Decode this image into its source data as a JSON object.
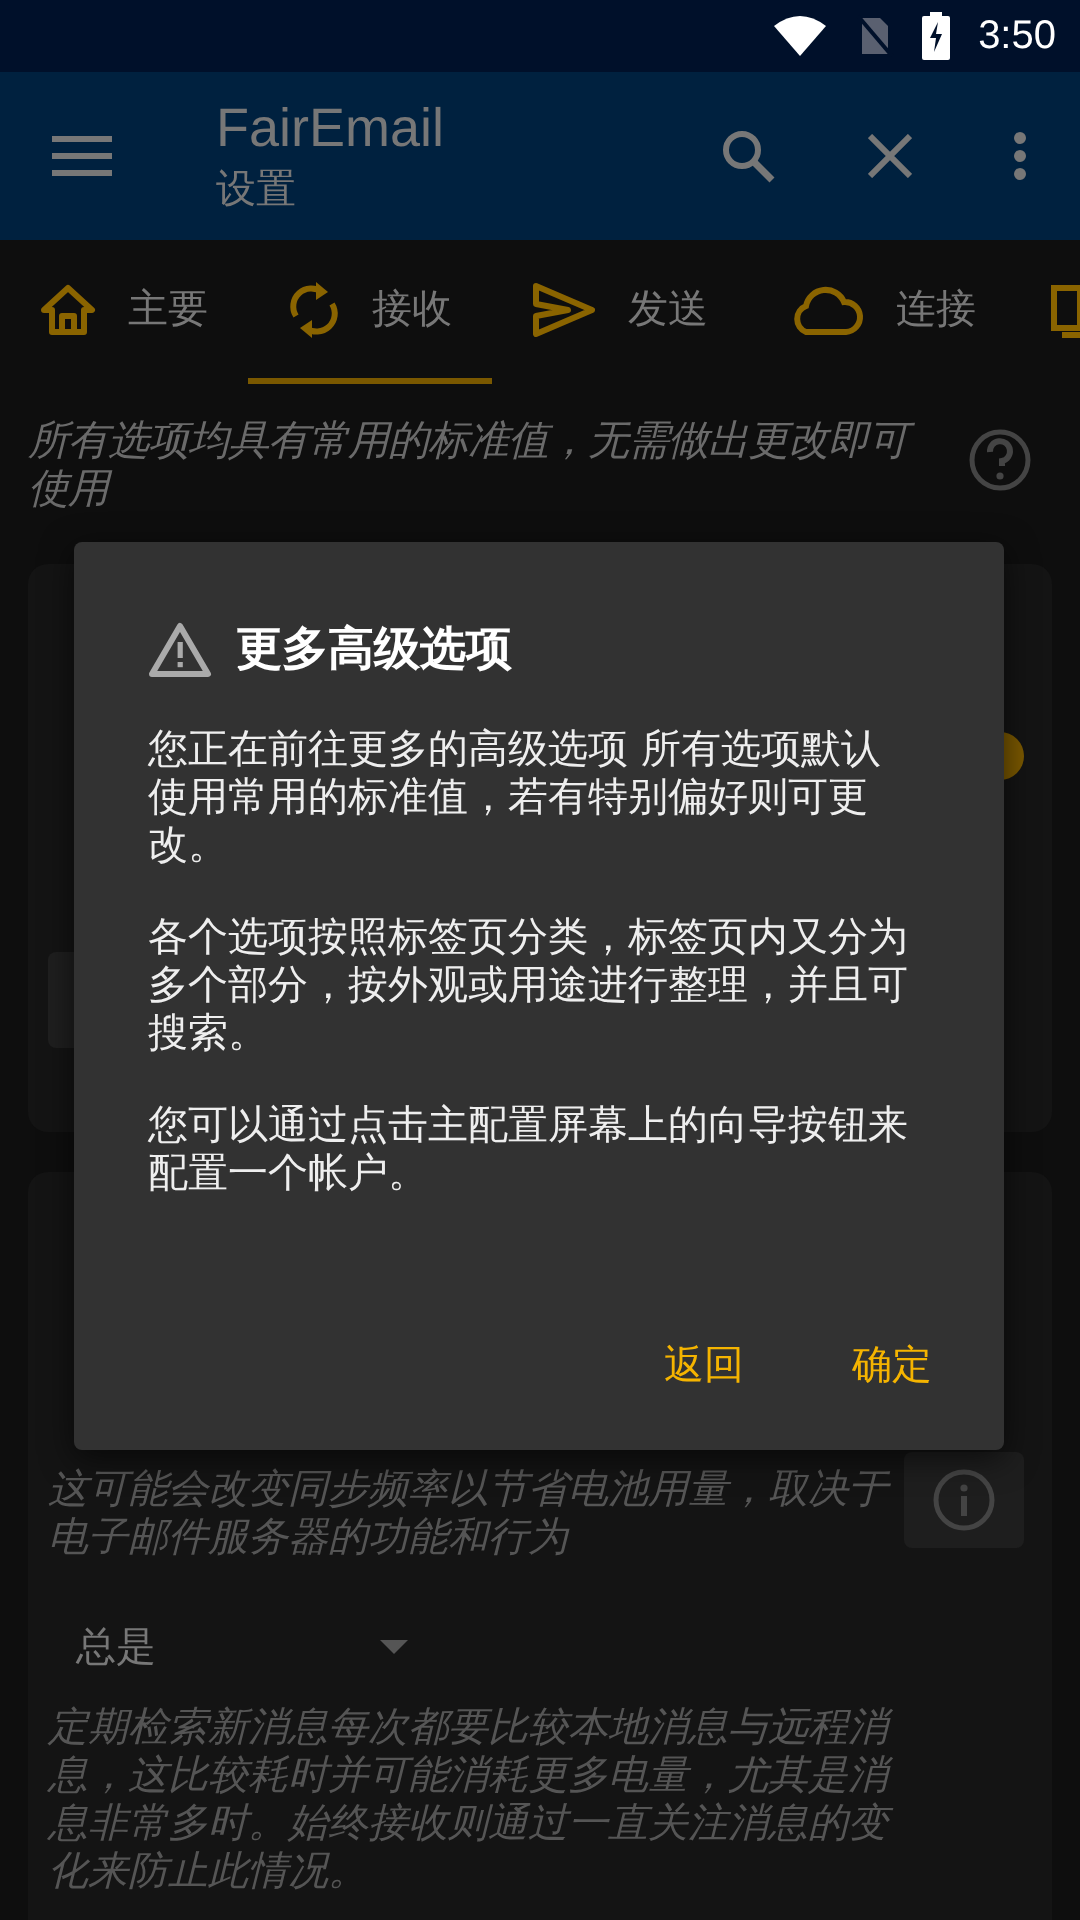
{
  "status_bar": {
    "time": "3:50"
  },
  "app_bar": {
    "title": "FairEmail",
    "subtitle": "设置"
  },
  "tabs": [
    {
      "label": "主要",
      "selected": false
    },
    {
      "label": "接收",
      "selected": true
    },
    {
      "label": "发送",
      "selected": false
    },
    {
      "label": "连接",
      "selected": false
    }
  ],
  "intro": {
    "text": "所有选项均具有常用的标准值，无需做出更改即可使用"
  },
  "card_1": {
    "switch_on": true
  },
  "card_2": {
    "hint": "这可能会改变同步频率以节省电池用量，取决于电子邮件服务器的功能和行为",
    "dropdown": {
      "value": "总是"
    },
    "description": "定期检索新消息每次都要比较本地消息与远程消息，这比较耗时并可能消耗更多电量，尤其是消息非常多时。始终接收则通过一直关注消息的变化来防止此情况。"
  },
  "dialog": {
    "title": "更多高级选项",
    "paragraphs": [
      "您正在前往更多的高级选项 所有选项默认使用常用的标准值，若有特别偏好则可更改。",
      "各个选项按照标签页分类，标签页内又分为多个部分，按外观或用途进行整理，并且可搜索。",
      "您可以通过点击主配置屏幕上的向导按钮来配置一个帐户。"
    ],
    "buttons": [
      "返回",
      "确定"
    ]
  }
}
